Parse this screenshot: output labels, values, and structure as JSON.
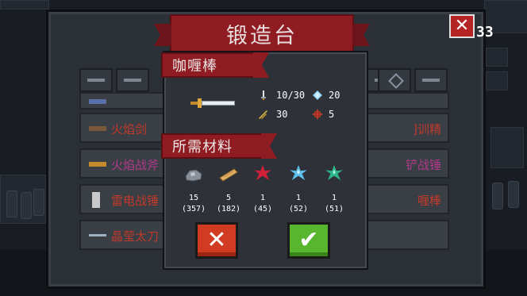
{
  "forge": {
    "title": "锻造台",
    "corner_count": "33",
    "close_glyph": "✕",
    "list_rows": [
      {
        "name_left": "",
        "name_right": "",
        "color": "#7a6fd0",
        "icon": "pipe-weapon-icon"
      },
      {
        "name_left": "火焰剑",
        "name_right": "]训精",
        "color": "#c0392b",
        "icon": "fire-sword-icon"
      },
      {
        "name_left": "火焰战斧",
        "name_right": "铲战锤",
        "color": "#b03a8a",
        "icon": "fire-axe-icon"
      },
      {
        "name_left": "雷电战锤",
        "name_right": "喱棒",
        "color": "#c0392b",
        "icon": "thunder-hammer-icon"
      },
      {
        "name_left": "晶莹太刀",
        "name_right": "",
        "color": "#c0392b",
        "icon": "crystal-katana-icon"
      }
    ]
  },
  "recipe": {
    "weapon_name": "咖喱棒",
    "weapon_icon": "golden-sword-icon",
    "stats": {
      "damage": "10/30",
      "energy": "20",
      "crit": "30",
      "accuracy": "5"
    },
    "materials_title": "所需材料",
    "materials": [
      {
        "icon": "iron-ore-icon",
        "required": "15",
        "have": "(357)"
      },
      {
        "icon": "wood-plank-icon",
        "required": "5",
        "have": "(182)"
      },
      {
        "icon": "red-crystal-icon",
        "required": "1",
        "have": "(45)"
      },
      {
        "icon": "blue-crystal-icon",
        "required": "1",
        "have": "(52)"
      },
      {
        "icon": "green-crystal-icon",
        "required": "1",
        "have": "(51)"
      }
    ],
    "cancel_glyph": "✕",
    "confirm_glyph": "✔"
  },
  "colors": {
    "banner_red": "#8e1c22",
    "cancel_red": "#d13b22",
    "confirm_green": "#58b52e"
  }
}
